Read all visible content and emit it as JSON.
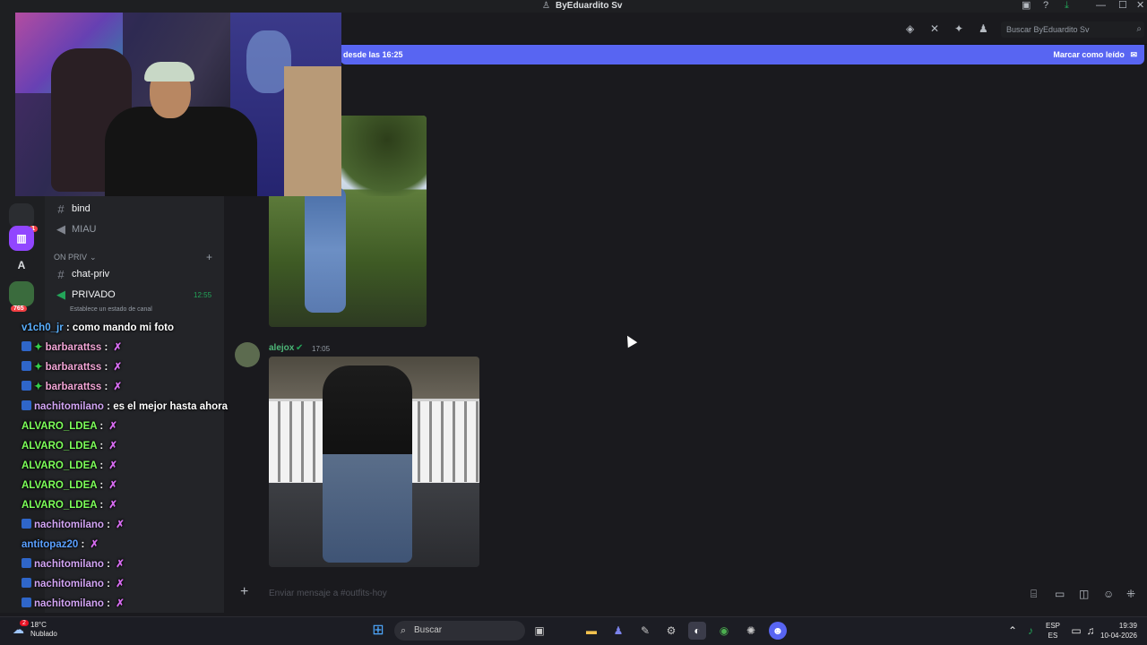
{
  "window": {
    "title": "ByEduardito Sv",
    "minimize": "—",
    "maximize": "☐",
    "close": "✕"
  },
  "topbar": {
    "search_placeholder": "Buscar ByEduardito Sv"
  },
  "banner": {
    "left_text": "desde las 16:25",
    "right_text": "Marcar como leído"
  },
  "rail": {
    "unread_badge": "1",
    "letter_server": "A",
    "count_badge": "765"
  },
  "channels": {
    "items": [
      {
        "label": "bind",
        "type": "text"
      },
      {
        "label": "MIAU",
        "type": "voice"
      }
    ],
    "category": "ON PRIV",
    "priv_items": [
      {
        "label": "chat-priv",
        "type": "text"
      },
      {
        "label": "PRIVADO",
        "type": "voice",
        "timer": "12:55",
        "status": "Establece un estado de canal"
      }
    ]
  },
  "messages": {
    "second_author": "alejox",
    "second_time": "17:05"
  },
  "composer": {
    "placeholder": "Enviar mensaje a #outfits-hoy"
  },
  "chat_overlay": [
    {
      "user": "v1ch0_jr",
      "color": "#5ab0ff",
      "text": "como mando mi foto",
      "badge": false
    },
    {
      "user": "barbarattss",
      "color": "#f2a5d6",
      "text": "",
      "badge": true,
      "sparkle": true
    },
    {
      "user": "barbarattss",
      "color": "#f2a5d6",
      "text": "",
      "badge": true,
      "sparkle": true
    },
    {
      "user": "barbarattss",
      "color": "#f2a5d6",
      "text": "",
      "badge": true,
      "sparkle": true
    },
    {
      "user": "nachitomilano",
      "color": "#d3a5f5",
      "text": "es el mejor hasta ahora",
      "badge": true
    },
    {
      "user": "ALVARO_LDEA",
      "color": "#7dff5a",
      "text": "",
      "badge": false
    },
    {
      "user": "ALVARO_LDEA",
      "color": "#7dff5a",
      "text": "",
      "badge": false
    },
    {
      "user": "ALVARO_LDEA",
      "color": "#7dff5a",
      "text": "",
      "badge": false
    },
    {
      "user": "ALVARO_LDEA",
      "color": "#7dff5a",
      "text": "",
      "badge": false
    },
    {
      "user": "ALVARO_LDEA",
      "color": "#7dff5a",
      "text": "",
      "badge": false
    },
    {
      "user": "nachitomilano",
      "color": "#d3a5f5",
      "text": "",
      "badge": true
    },
    {
      "user": "antitopaz20",
      "color": "#5aa0ff",
      "text": "",
      "badge": false
    },
    {
      "user": "nachitomilano",
      "color": "#d3a5f5",
      "text": "",
      "badge": true
    },
    {
      "user": "nachitomilano",
      "color": "#d3a5f5",
      "text": "",
      "badge": true
    },
    {
      "user": "nachitomilano",
      "color": "#d3a5f5",
      "text": "",
      "badge": true
    }
  ],
  "taskbar": {
    "weather_temp": "18°C",
    "weather_desc": "Nublado",
    "weather_badge": "2",
    "search_label": "Buscar",
    "lang_top": "ESP",
    "lang_bottom": "ES",
    "time": "19:39",
    "date": "10-04-2026"
  }
}
